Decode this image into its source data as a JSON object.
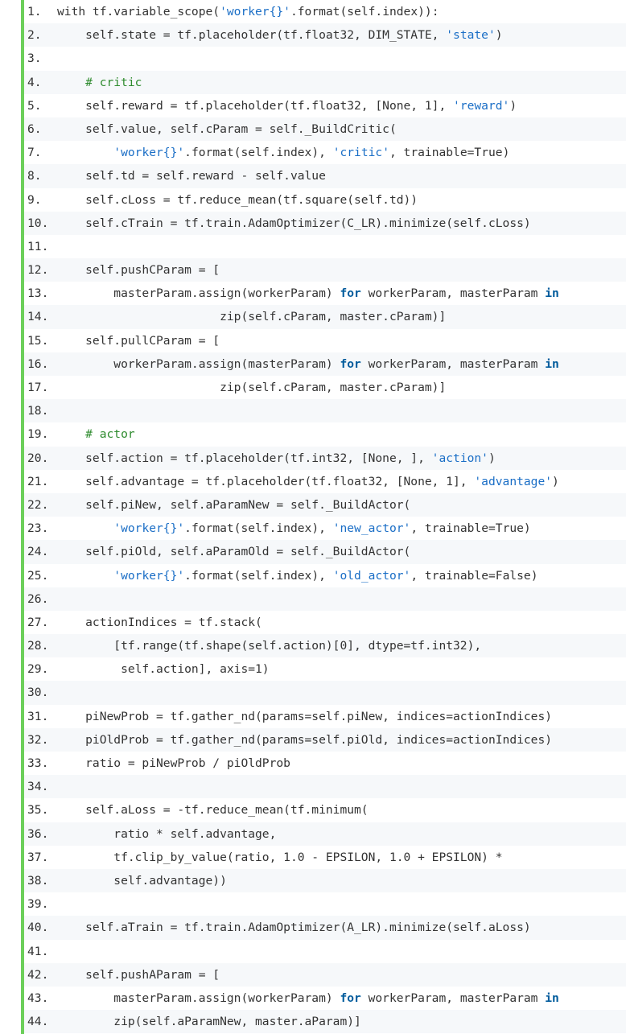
{
  "accent_bar_color": "#6ccf5a",
  "colors": {
    "string": "#1a6ec6",
    "comment": "#2e8b2e",
    "keyword": "#005b9c",
    "text": "#333333",
    "stripe": "#f6f8fa"
  },
  "lines": [
    {
      "n": "1.",
      "t": [
        [
          "p",
          "with tf.variable_scope("
        ],
        [
          "s",
          "'worker{}'"
        ],
        [
          "p",
          ".format(self.index)):"
        ]
      ]
    },
    {
      "n": "2.",
      "t": [
        [
          "p",
          "    self.state = tf.placeholder(tf.float32, DIM_STATE, "
        ],
        [
          "s",
          "'state'"
        ],
        [
          "p",
          ")"
        ]
      ]
    },
    {
      "n": "3.",
      "t": []
    },
    {
      "n": "4.",
      "t": [
        [
          "p",
          "    "
        ],
        [
          "c",
          "# critic"
        ]
      ]
    },
    {
      "n": "5.",
      "t": [
        [
          "p",
          "    self.reward = tf.placeholder(tf.float32, [None, 1], "
        ],
        [
          "s",
          "'reward'"
        ],
        [
          "p",
          ")"
        ]
      ]
    },
    {
      "n": "6.",
      "t": [
        [
          "p",
          "    self.value, self.cParam = self._BuildCritic("
        ]
      ]
    },
    {
      "n": "7.",
      "t": [
        [
          "p",
          "        "
        ],
        [
          "s",
          "'worker{}'"
        ],
        [
          "p",
          ".format(self.index), "
        ],
        [
          "s",
          "'critic'"
        ],
        [
          "p",
          ", trainable=True)"
        ]
      ]
    },
    {
      "n": "8.",
      "t": [
        [
          "p",
          "    self.td = self.reward - self.value"
        ]
      ]
    },
    {
      "n": "9.",
      "t": [
        [
          "p",
          "    self.cLoss = tf.reduce_mean(tf.square(self.td))"
        ]
      ]
    },
    {
      "n": "10.",
      "t": [
        [
          "p",
          "    self.cTrain = tf.train.AdamOptimizer(C_LR).minimize(self.cLoss)"
        ]
      ]
    },
    {
      "n": "11.",
      "t": []
    },
    {
      "n": "12.",
      "t": [
        [
          "p",
          "    self.pushCParam = ["
        ]
      ]
    },
    {
      "n": "13.",
      "t": [
        [
          "p",
          "        masterParam.assign(workerParam) "
        ],
        [
          "k",
          "for"
        ],
        [
          "p",
          " workerParam, masterParam "
        ],
        [
          "k",
          "in"
        ]
      ]
    },
    {
      "n": "14.",
      "t": [
        [
          "p",
          "                       zip(self.cParam, master.cParam)]"
        ]
      ]
    },
    {
      "n": "15.",
      "t": [
        [
          "p",
          "    self.pullCParam = ["
        ]
      ]
    },
    {
      "n": "16.",
      "t": [
        [
          "p",
          "        workerParam.assign(masterParam) "
        ],
        [
          "k",
          "for"
        ],
        [
          "p",
          " workerParam, masterParam "
        ],
        [
          "k",
          "in"
        ]
      ]
    },
    {
      "n": "17.",
      "t": [
        [
          "p",
          "                       zip(self.cParam, master.cParam)]"
        ]
      ]
    },
    {
      "n": "18.",
      "t": []
    },
    {
      "n": "19.",
      "t": [
        [
          "p",
          "    "
        ],
        [
          "c",
          "# actor"
        ]
      ]
    },
    {
      "n": "20.",
      "t": [
        [
          "p",
          "    self.action = tf.placeholder(tf.int32, [None, ], "
        ],
        [
          "s",
          "'action'"
        ],
        [
          "p",
          ")"
        ]
      ]
    },
    {
      "n": "21.",
      "t": [
        [
          "p",
          "    self.advantage = tf.placeholder(tf.float32, [None, 1], "
        ],
        [
          "s",
          "'advantage'"
        ],
        [
          "p",
          ")"
        ]
      ]
    },
    {
      "n": "22.",
      "t": [
        [
          "p",
          "    self.piNew, self.aParamNew = self._BuildActor("
        ]
      ]
    },
    {
      "n": "23.",
      "t": [
        [
          "p",
          "        "
        ],
        [
          "s",
          "'worker{}'"
        ],
        [
          "p",
          ".format(self.index), "
        ],
        [
          "s",
          "'new_actor'"
        ],
        [
          "p",
          ", trainable=True)"
        ]
      ]
    },
    {
      "n": "24.",
      "t": [
        [
          "p",
          "    self.piOld, self.aParamOld = self._BuildActor("
        ]
      ]
    },
    {
      "n": "25.",
      "t": [
        [
          "p",
          "        "
        ],
        [
          "s",
          "'worker{}'"
        ],
        [
          "p",
          ".format(self.index), "
        ],
        [
          "s",
          "'old_actor'"
        ],
        [
          "p",
          ", trainable=False)"
        ]
      ]
    },
    {
      "n": "26.",
      "t": []
    },
    {
      "n": "27.",
      "t": [
        [
          "p",
          "    actionIndices = tf.stack("
        ]
      ]
    },
    {
      "n": "28.",
      "t": [
        [
          "p",
          "        [tf.range(tf.shape(self.action)[0], dtype=tf.int32),"
        ]
      ]
    },
    {
      "n": "29.",
      "t": [
        [
          "p",
          "         self.action], axis=1)"
        ]
      ]
    },
    {
      "n": "30.",
      "t": []
    },
    {
      "n": "31.",
      "t": [
        [
          "p",
          "    piNewProb = tf.gather_nd(params=self.piNew, indices=actionIndices)"
        ]
      ]
    },
    {
      "n": "32.",
      "t": [
        [
          "p",
          "    piOldProb = tf.gather_nd(params=self.piOld, indices=actionIndices)"
        ]
      ]
    },
    {
      "n": "33.",
      "t": [
        [
          "p",
          "    ratio = piNewProb / piOldProb"
        ]
      ]
    },
    {
      "n": "34.",
      "t": []
    },
    {
      "n": "35.",
      "t": [
        [
          "p",
          "    self.aLoss = -tf.reduce_mean(tf.minimum("
        ]
      ]
    },
    {
      "n": "36.",
      "t": [
        [
          "p",
          "        ratio * self.advantage,"
        ]
      ]
    },
    {
      "n": "37.",
      "t": [
        [
          "p",
          "        tf.clip_by_value(ratio, 1.0 - EPSILON, 1.0 + EPSILON) *"
        ]
      ]
    },
    {
      "n": "38.",
      "t": [
        [
          "p",
          "        self.advantage))"
        ]
      ]
    },
    {
      "n": "39.",
      "t": []
    },
    {
      "n": "40.",
      "t": [
        [
          "p",
          "    self.aTrain = tf.train.AdamOptimizer(A_LR).minimize(self.aLoss)"
        ]
      ]
    },
    {
      "n": "41.",
      "t": []
    },
    {
      "n": "42.",
      "t": [
        [
          "p",
          "    self.pushAParam = ["
        ]
      ]
    },
    {
      "n": "43.",
      "t": [
        [
          "p",
          "        masterParam.assign(workerParam) "
        ],
        [
          "k",
          "for"
        ],
        [
          "p",
          " workerParam, masterParam "
        ],
        [
          "k",
          "in"
        ]
      ]
    },
    {
      "n": "44.",
      "t": [
        [
          "p",
          "        zip(self.aParamNew, master.aParam)]"
        ]
      ]
    }
  ]
}
